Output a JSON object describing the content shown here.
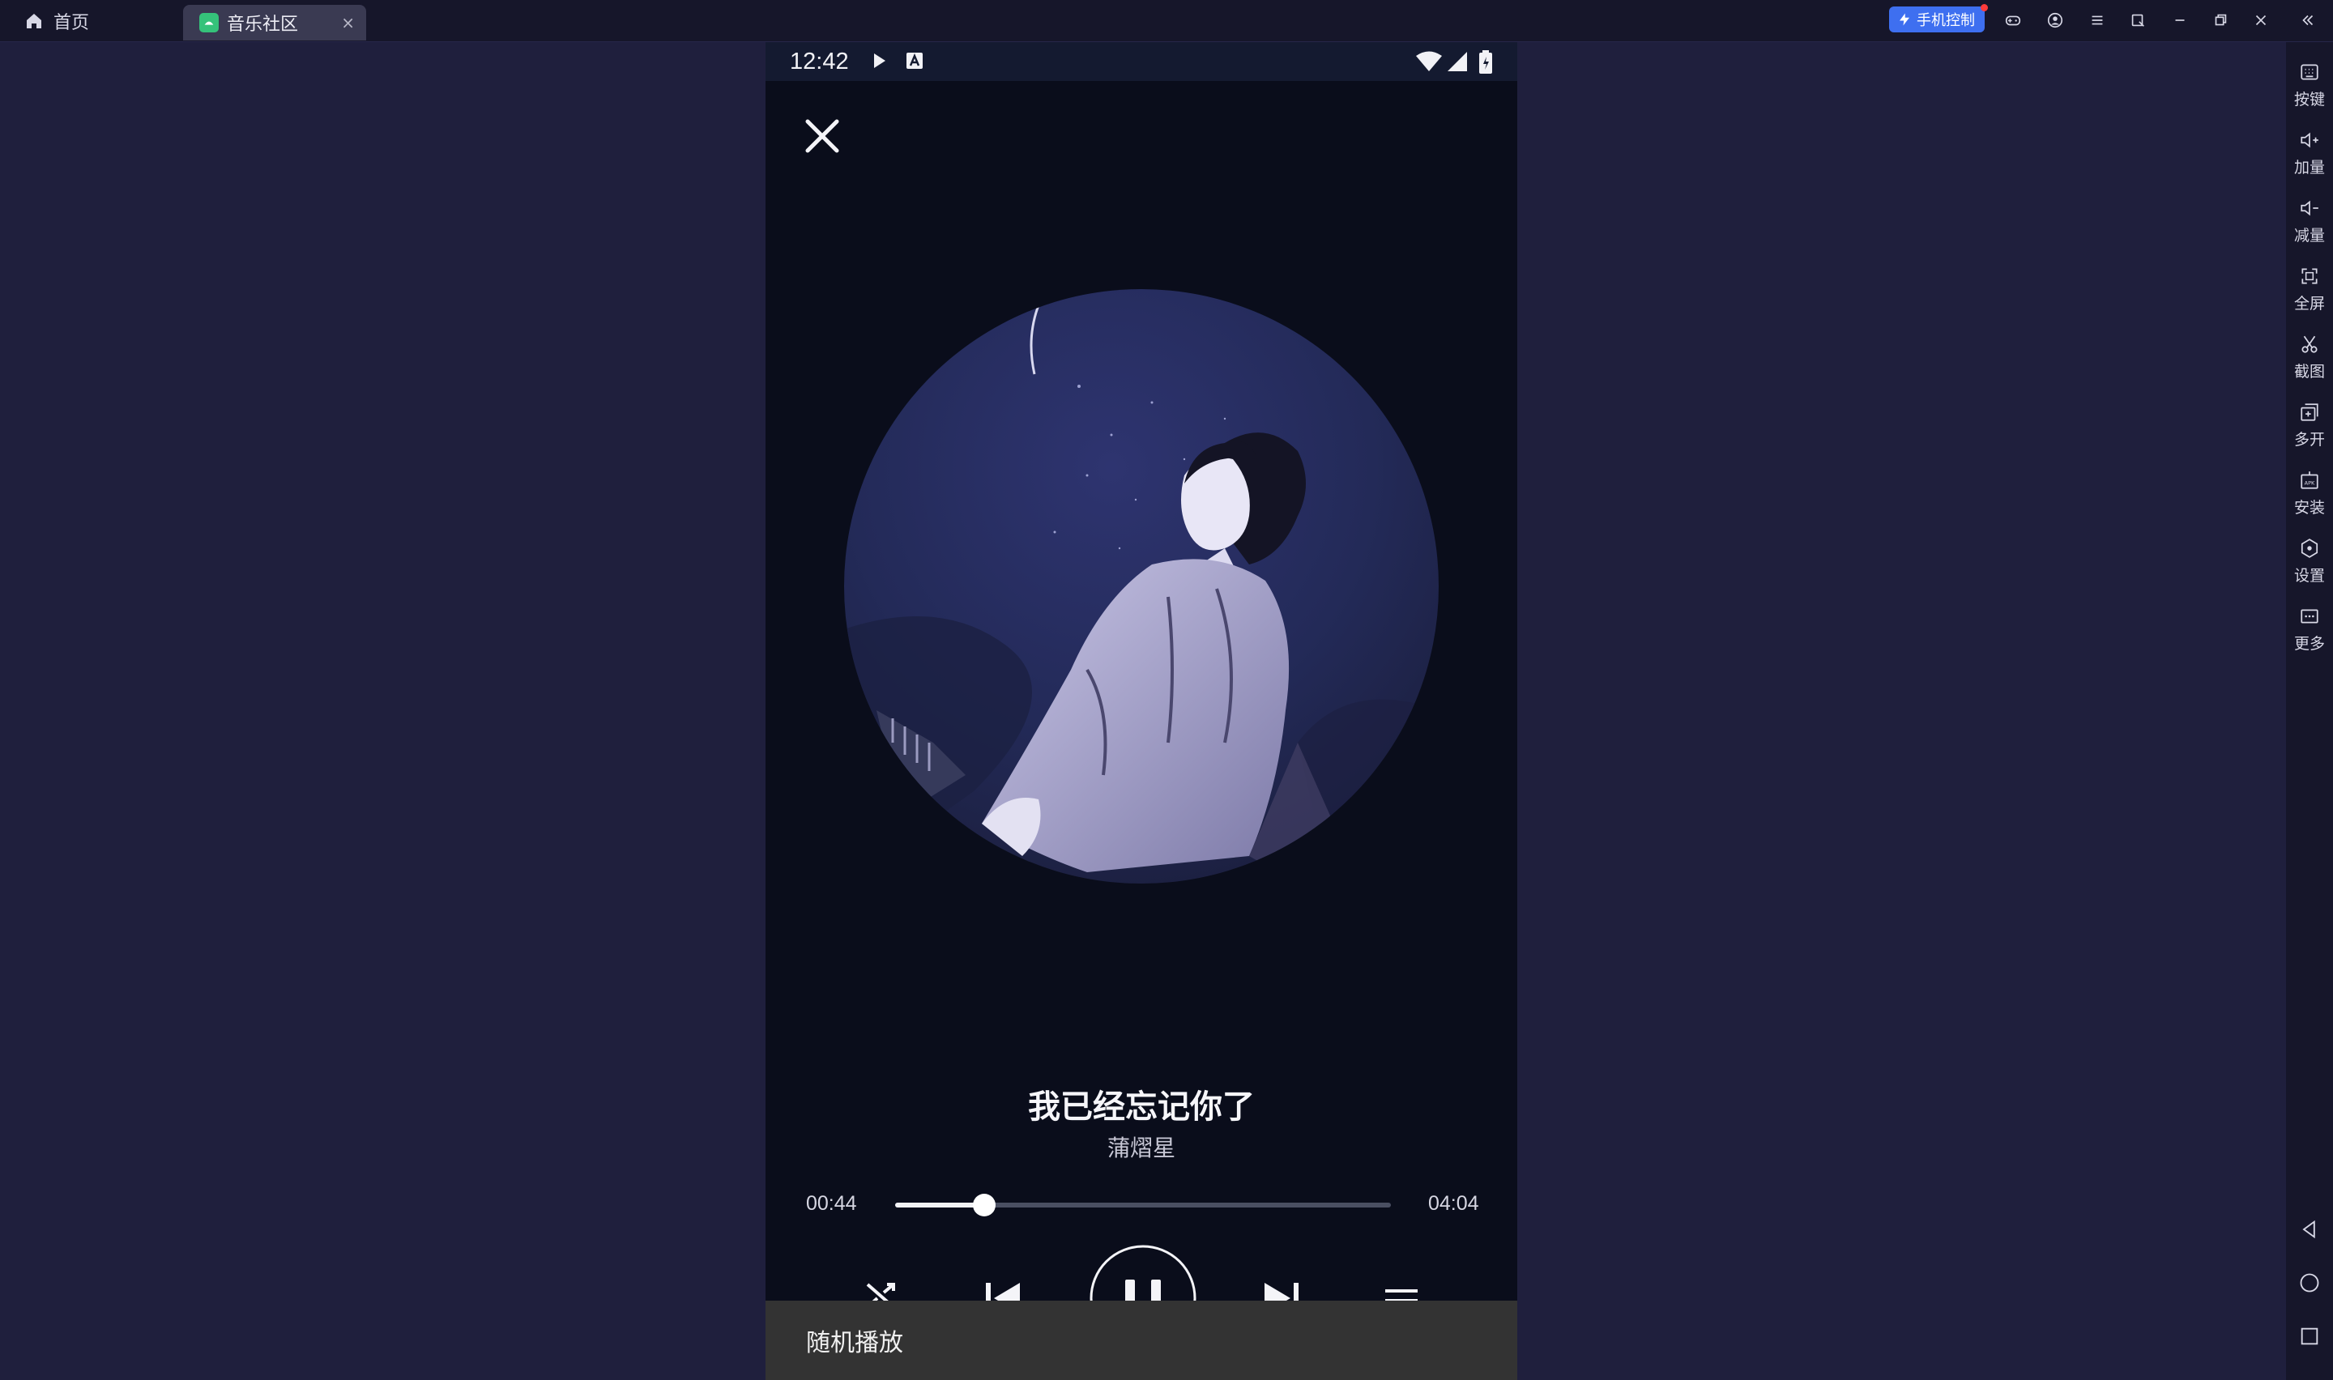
{
  "titlebar": {
    "home_tab_label": "首页",
    "app_tab_label": "音乐社区",
    "app_tab_close": "×",
    "phone_control_label": "手机控制"
  },
  "sidebar": {
    "items": [
      {
        "label": "按键",
        "icon": "keyboard-icon"
      },
      {
        "label": "加量",
        "icon": "volume-up-icon"
      },
      {
        "label": "减量",
        "icon": "volume-down-icon"
      },
      {
        "label": "全屏",
        "icon": "fullscreen-icon"
      },
      {
        "label": "截图",
        "icon": "scissors-icon"
      },
      {
        "label": "多开",
        "icon": "multi-instance-icon"
      },
      {
        "label": "安装",
        "icon": "apk-install-icon"
      },
      {
        "label": "设置",
        "icon": "settings-icon"
      },
      {
        "label": "更多",
        "icon": "more-icon"
      }
    ]
  },
  "phone": {
    "status_time": "12:42",
    "song_title": "我已经忘记你了",
    "artist": "蒲熠星",
    "current_time": "00:44",
    "total_time": "04:04",
    "progress_fraction": 0.18,
    "toast_text": "随机播放"
  },
  "colors": {
    "desktop_bg": "#1f1f3d",
    "phone_bg": "#0a0d1b",
    "accent_blue": "#3e6ff0",
    "tab_logo_green": "#35c27a"
  }
}
